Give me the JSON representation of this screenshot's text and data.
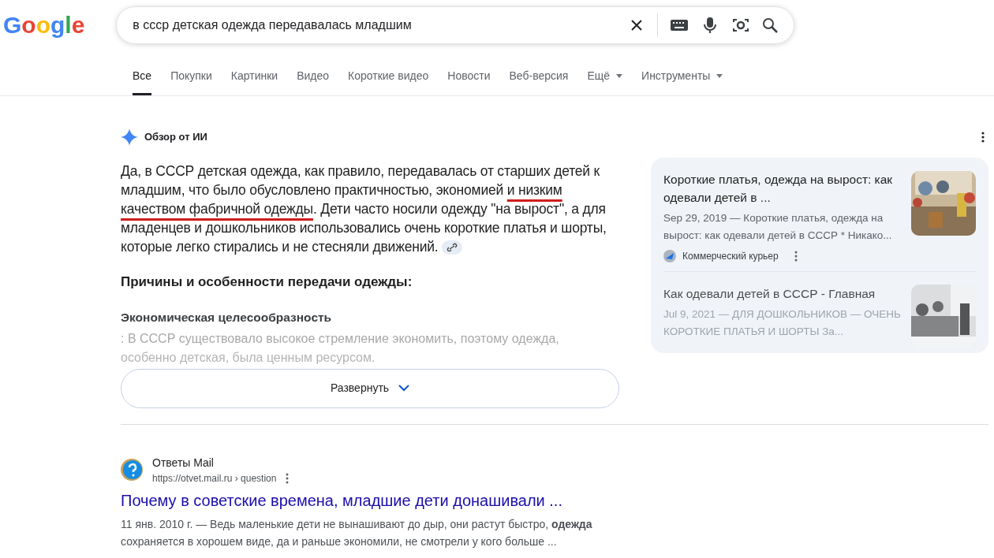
{
  "logo": "Google",
  "search": {
    "value": "в ссср детская одежда передавалась младшим"
  },
  "tabs": [
    {
      "label": "Все",
      "selected": true,
      "menu": false
    },
    {
      "label": "Покупки",
      "selected": false,
      "menu": false
    },
    {
      "label": "Картинки",
      "selected": false,
      "menu": false
    },
    {
      "label": "Видео",
      "selected": false,
      "menu": false
    },
    {
      "label": "Короткие видео",
      "selected": false,
      "menu": false
    },
    {
      "label": "Новости",
      "selected": false,
      "menu": false
    },
    {
      "label": "Веб-версия",
      "selected": false,
      "menu": false
    },
    {
      "label": "Ещё",
      "selected": false,
      "menu": true
    },
    {
      "label": "Инструменты",
      "selected": false,
      "menu": true
    }
  ],
  "ai_overview": {
    "title": "Обзор от ИИ",
    "answer": [
      {
        "text": "Да, в СССР детская одежда, как правило, передавалась от старших детей к младшим, что было обусловлено практичностью, экономией ",
        "underlined": false
      },
      {
        "text": "и низким качеством фабричной одежды",
        "underlined": true
      },
      {
        "text": ". Дети часто носили одежду \"на вырост\", а для младенцев и дошкольников использовались очень короткие платья и шорты, которые легко стирались и не стесняли движений.",
        "underlined": false
      }
    ],
    "heading": "Причины и особенности передачи одежды:",
    "subheading": "Экономическая целесообразность",
    "faded_lines": [
      ": В СССР существовало высокое стремление экономить, поэтому одежда,",
      "особенно детская, была ценным ресурсом."
    ],
    "expand_button": "Развернуть",
    "sources": [
      {
        "title": "Короткие платья, одежда на вырост: как одевали детей в ...",
        "snippet": "Sep 29, 2019 — Короткие платья, одежда на вырост: как одевали детей в СССР * Никако...",
        "site": "Коммерческий курьер",
        "faded": false
      },
      {
        "title": "Как одевали детей в СССР - Главная",
        "snippet": "Jul 9, 2021 — ДЛЯ ДОШКОЛЬНИКОВ — ОЧЕНЬ КОРОТКИЕ ПЛАТЬЯ И ШОРТЫ За...",
        "faded": true
      }
    ]
  },
  "results": [
    {
      "site": "Ответы Mail",
      "url": "https://otvet.mail.ru › question",
      "title": "Почему в советские времена, младшие дети донашивали ...",
      "snippet": "11 янв. 2010 г. — Ведь маленькие дети не вынашивают до дыр, они растут быстро, **одежда** сохраняется в хорошем виде, да и раньше экономили, не смотрели у кого больше ..."
    }
  ]
}
